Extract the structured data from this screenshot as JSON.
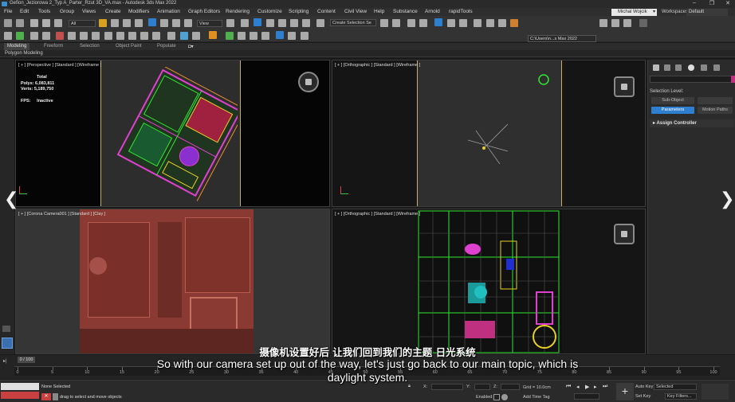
{
  "window": {
    "title": "Gefion_Jeziorowa 2_Typ A_Parter_Rzut 3D_VA.max - Autodesk 3ds Max 2022",
    "controls": [
      "–",
      "❐",
      "✕"
    ]
  },
  "menu": {
    "items": [
      "File",
      "Edit",
      "Tools",
      "Group",
      "Views",
      "Create",
      "Modifiers",
      "Animation",
      "Graph Editors",
      "Rendering",
      "Customize",
      "Scripting",
      "Content",
      "Civil View",
      "Help",
      "Substance",
      "Arnold",
      "rapidTools"
    ],
    "user": "Michal Wojcik",
    "workspace_label": "Workspaces:",
    "workspace_value": "Default"
  },
  "toolbar": {
    "filter": "All",
    "view": "View",
    "selection_set": "Create Selection Se",
    "path": "C:\\Users\\n...s Max 2022"
  },
  "ribbon": {
    "tabs": [
      "Modeling",
      "Freeform",
      "Selection",
      "Object Paint",
      "Populate"
    ],
    "subtitle": "Polygon Modeling"
  },
  "viewports": {
    "top_left": {
      "label": "[ + ] [Perspective ] [Standard ] [Wireframe ]",
      "stats": {
        "total_label": "Total",
        "polys_label": "Polys:",
        "polys": "6,083,811",
        "verts_label": "Verts:",
        "verts": "5,189,750",
        "fps_label": "FPS:",
        "fps": "Inactive"
      }
    },
    "top_right": {
      "label": "[ + ] [Orthographic ] [Standard ] [Wireframe ]"
    },
    "bottom_left": {
      "label": "[ + ] [Corona Camera001 ] [Standard ] [Clay ]"
    },
    "bottom_right": {
      "label": "[ + ] [Orthographic ] [Standard ] [Wireframe ]"
    }
  },
  "command_panel": {
    "selection_level": "Selection Level:",
    "sub_object": "Sub-Object",
    "parameters": "Parameters",
    "motion_paths": "Motion Paths",
    "assign_controller": "Assign Controller"
  },
  "subtitles": {
    "cn": "摄像机设置好后 让我们回到我们的主题 日光系统",
    "en_line1": "So with our camera set up out of the way, let's just go back to our main topic, which is",
    "en_line2": "daylight system."
  },
  "timeline": {
    "slider": "0 / 100",
    "ticks": [
      "0",
      "5",
      "10",
      "15",
      "20",
      "25",
      "30",
      "35",
      "40",
      "45",
      "50",
      "55",
      "60",
      "65",
      "70",
      "75",
      "80",
      "85",
      "90",
      "95",
      "100"
    ]
  },
  "status": {
    "selection": "None Selected",
    "hint": "drag to select and move objects",
    "x_label": "X:",
    "y_label": "Y:",
    "z_label": "Z:",
    "enabled_label": "Enabled:",
    "grid": "Grid = 10.0cm",
    "add_time_tag": "Add Time Tag",
    "auto_key": "Auto Key",
    "set_key": "Set Key",
    "selected": "Selected",
    "key_filters": "Key Filters..."
  },
  "colors": {
    "accent_blue": "#2f7fd1",
    "clay_red": "#8a3a32",
    "wire_green": "#2ee82e",
    "wire_magenta": "#e040d0",
    "wire_yellow": "#e8d020"
  }
}
